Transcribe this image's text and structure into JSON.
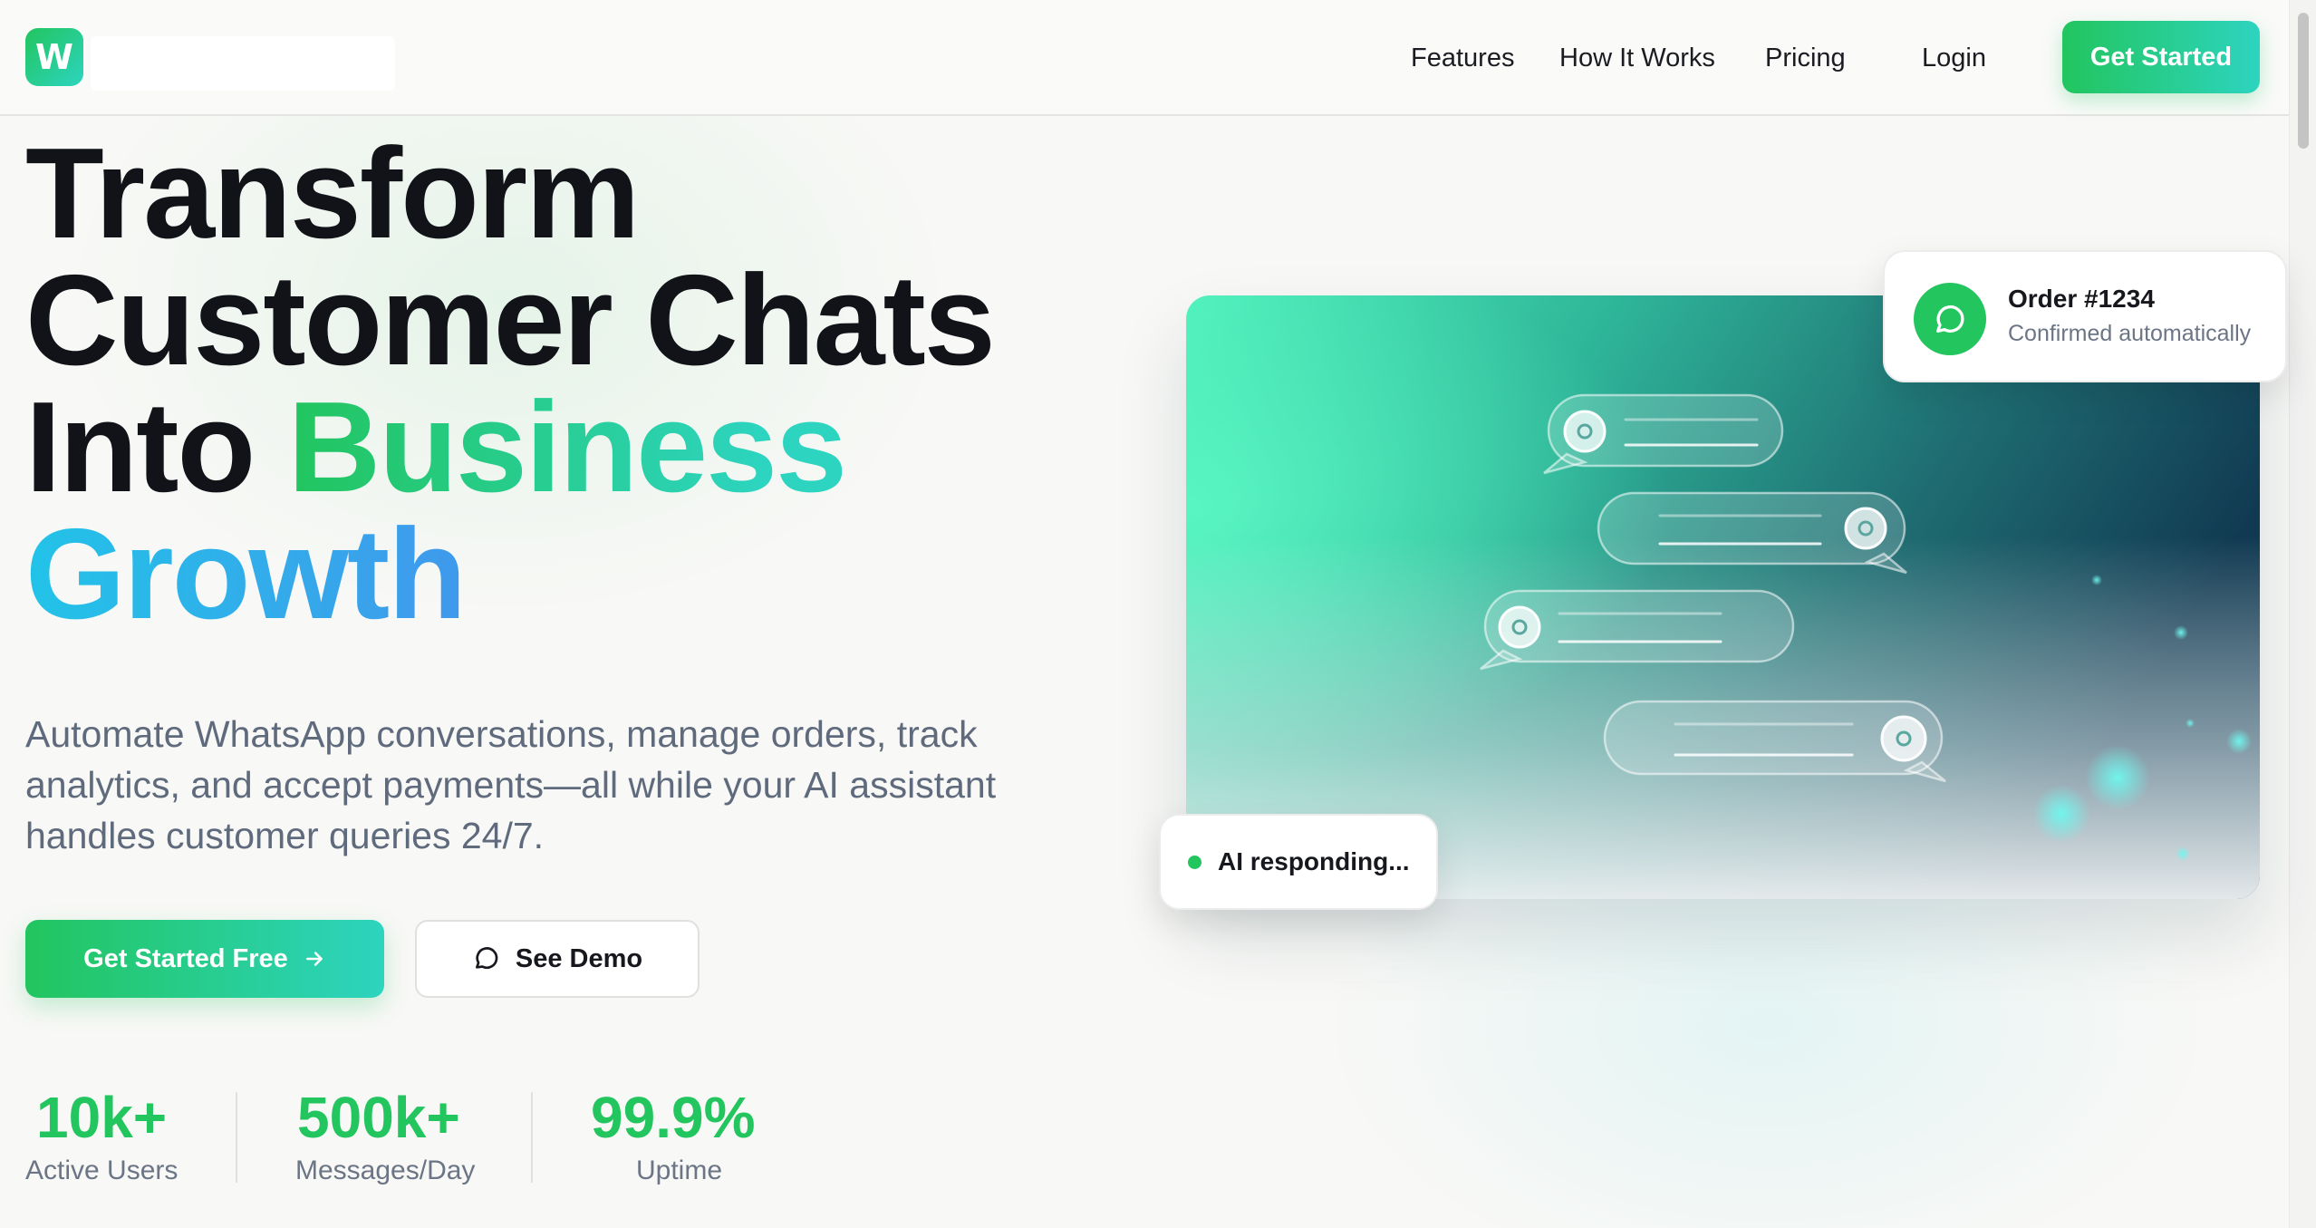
{
  "brand": {
    "logo_letter": "W"
  },
  "nav": {
    "links": [
      "Features",
      "How It Works",
      "Pricing",
      "Login"
    ],
    "cta": "Get Started"
  },
  "hero": {
    "line1": "Transform",
    "line2": "Customer Chats",
    "line3_plain": "Into ",
    "line3_accent": "Business",
    "line4_accent": "Growth",
    "subtext": "Automate WhatsApp conversations, manage orders, track analytics, and accept payments—all while your AI assistant handles customer queries 24/7.",
    "primary_button": "Get Started Free",
    "secondary_button": "See Demo"
  },
  "stats": [
    {
      "value": "10k+",
      "label": "Active Users"
    },
    {
      "value": "500k+",
      "label": "Messages/Day"
    },
    {
      "value": "99.9%",
      "label": "Uptime"
    }
  ],
  "notification": {
    "title": "Order #1234",
    "subtitle": "Confirmed automatically"
  },
  "status": {
    "text": "AI responding..."
  },
  "icons": {
    "logo": "logo-icon",
    "arrow": "arrow-right-icon",
    "chat": "chat-bubble-icon",
    "whatsapp": "whatsapp-icon",
    "status_dot": "status-dot-icon"
  },
  "colors": {
    "accent_green": "#22c55e",
    "accent_teal": "#2dd4bf",
    "accent_blue": "#22c3e8",
    "accent_indigo": "#6366f1",
    "text_dark": "#111318",
    "text_muted": "#5f6b7d"
  }
}
